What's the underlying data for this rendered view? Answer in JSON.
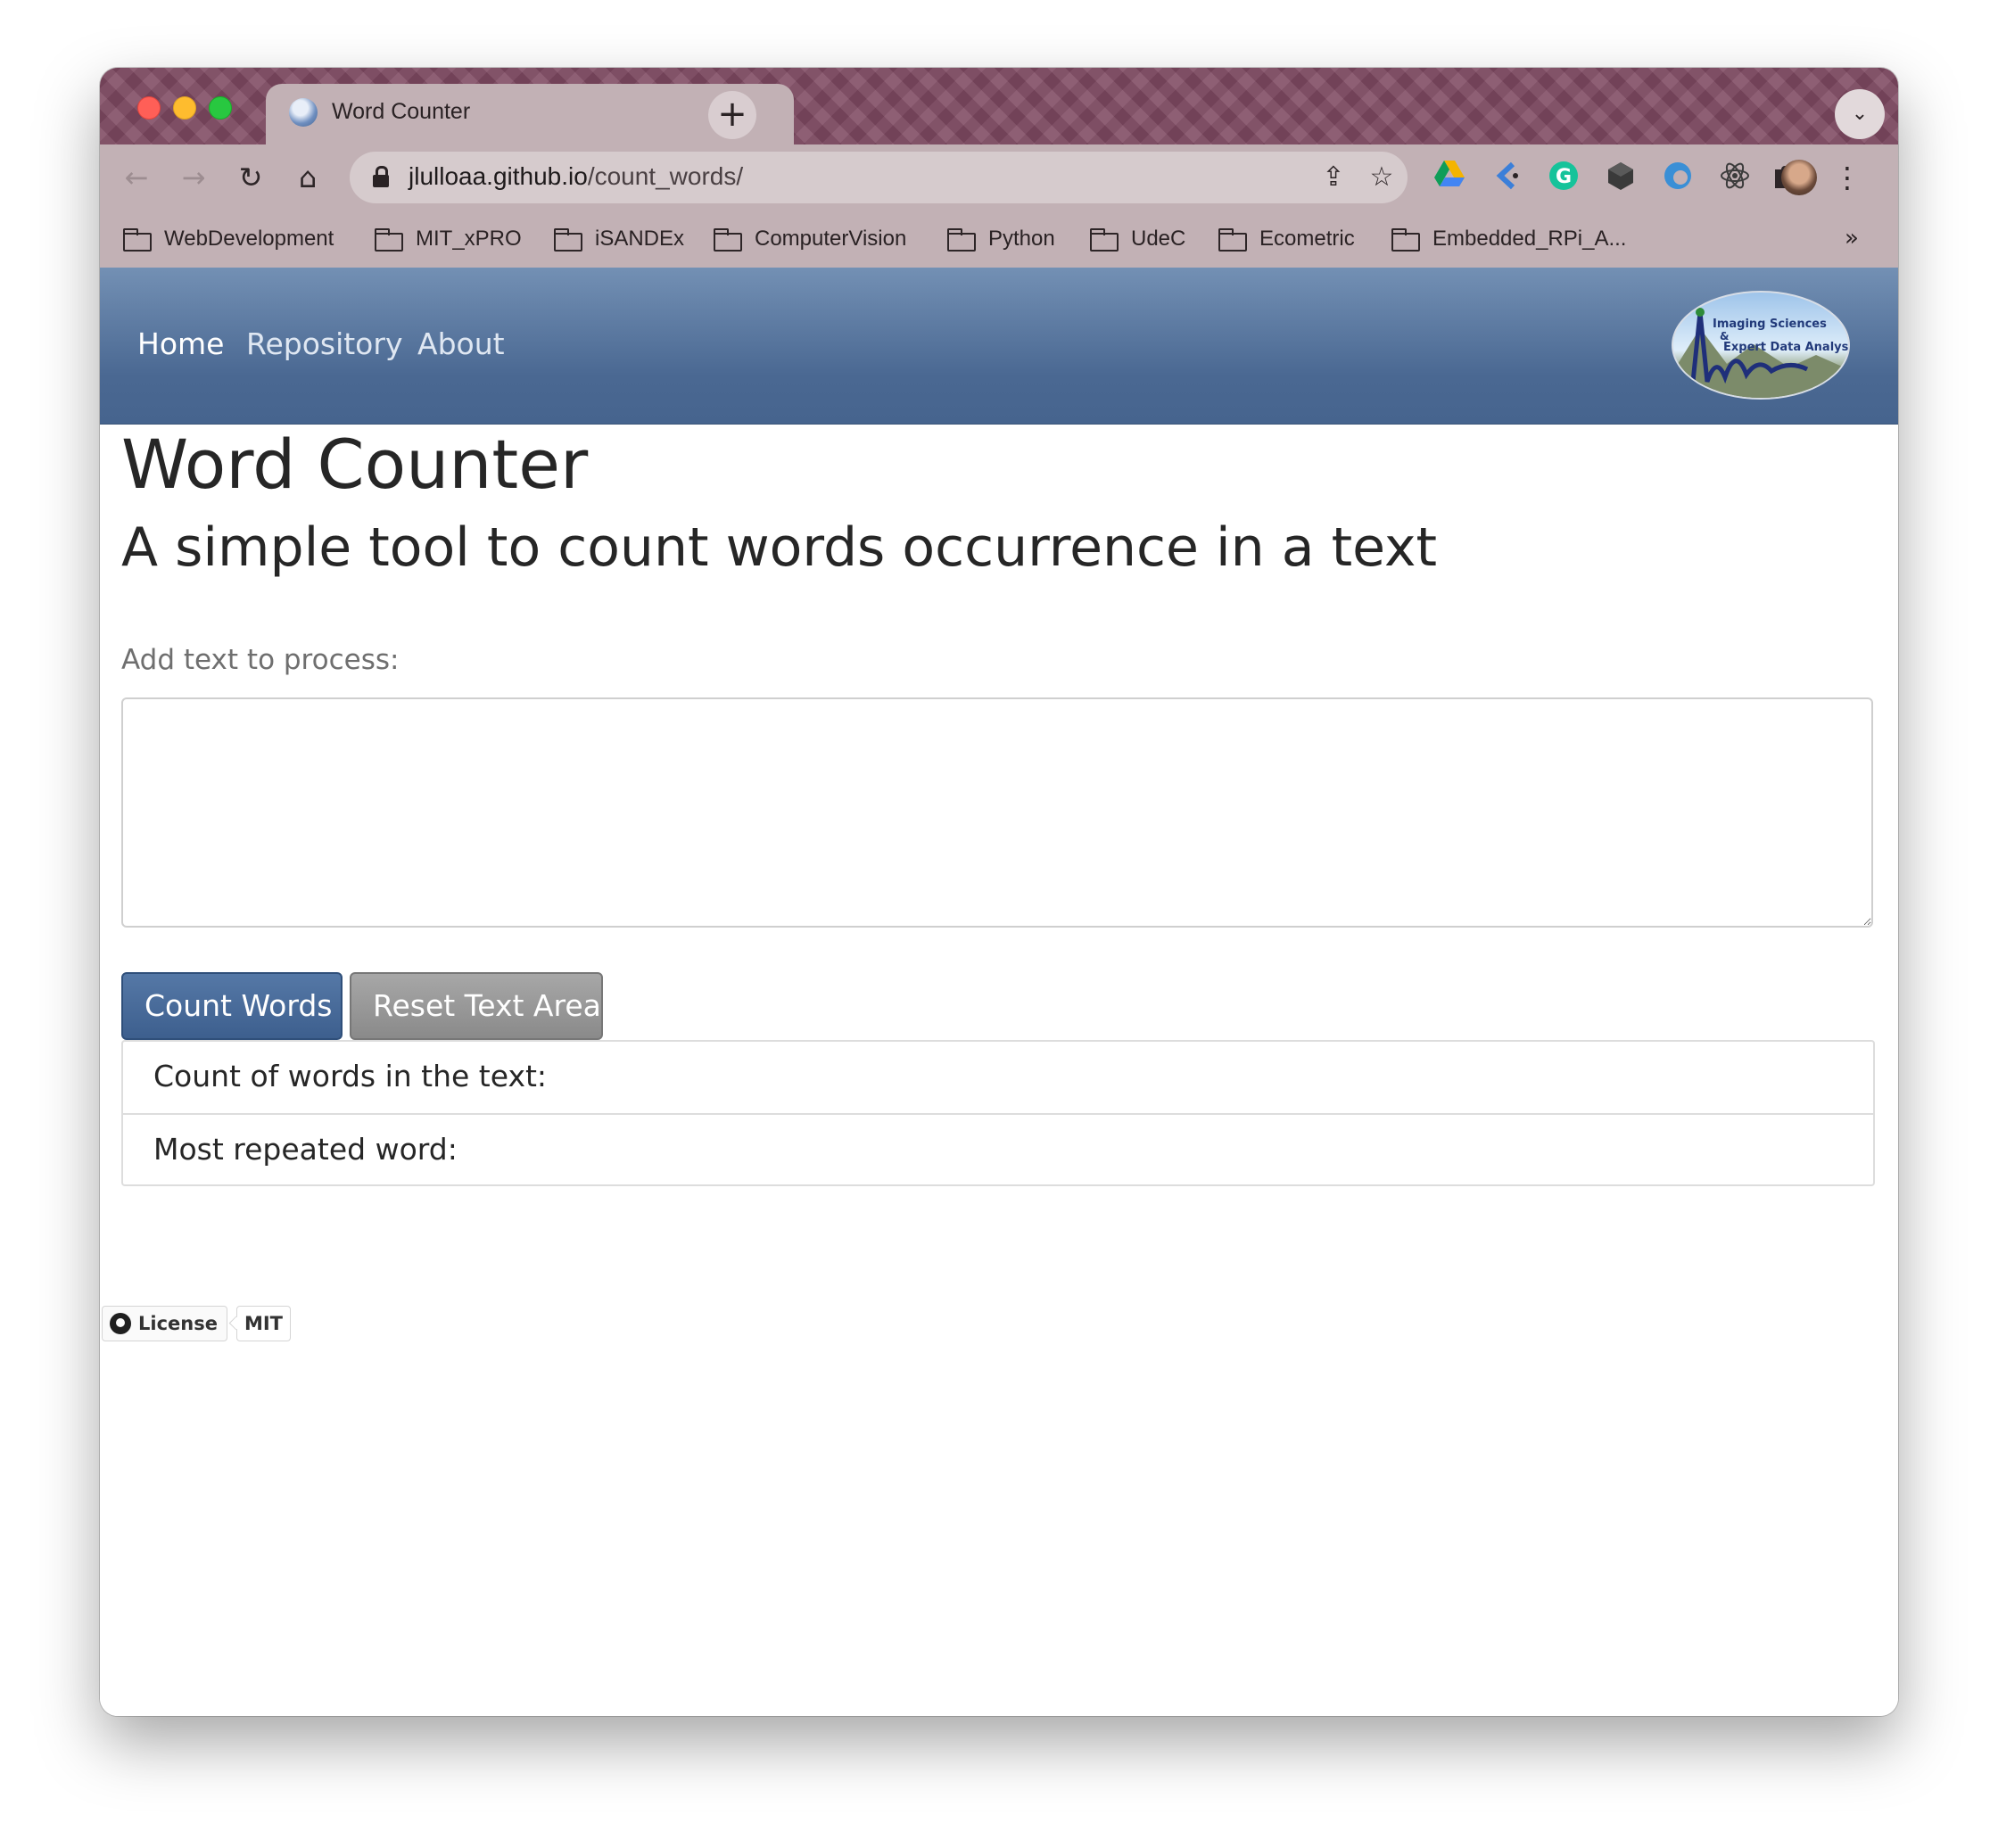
{
  "browser": {
    "tab_title": "Word Counter",
    "url_host": "jlulloaa.github.io",
    "url_path": "/count_words/",
    "bookmarks": [
      {
        "label": "WebDevelopment"
      },
      {
        "label": "MIT_xPRO"
      },
      {
        "label": "iSANDEx"
      },
      {
        "label": "ComputerVision"
      },
      {
        "label": "Python"
      },
      {
        "label": "UdeC"
      },
      {
        "label": "Ecometric"
      },
      {
        "label": "Embedded_RPi_A..."
      }
    ],
    "bookmarks_overflow": "»",
    "extension_icons": [
      "google-drive-icon",
      "klarna-icon",
      "grammarly-icon",
      "cube-icon",
      "edge-icon",
      "react-icon",
      "puzzle-icon"
    ]
  },
  "navbar": {
    "links": [
      {
        "label": "Home"
      },
      {
        "label": "Repository"
      },
      {
        "label": "About"
      }
    ],
    "logo": {
      "line1": "Imaging Sciences",
      "amp": "&",
      "line2": "Expert Data Analysis"
    }
  },
  "main": {
    "title": "Word Counter",
    "subtitle": "A simple tool to count words occurrence in a text",
    "input_label": "Add text to process:",
    "textarea_value": "",
    "count_button": "Count Words",
    "reset_button": "Reset Text Area",
    "results": [
      {
        "label": "Count of words in the text:"
      },
      {
        "label": "Most repeated word:"
      }
    ]
  },
  "footer": {
    "badge_label": "License",
    "badge_value": "MIT"
  },
  "colors": {
    "navbar": "#4a6892",
    "primary_button": "#3d5f8e",
    "secondary_button": "#8a8a8a",
    "tabstrip": "#7f4a62"
  }
}
